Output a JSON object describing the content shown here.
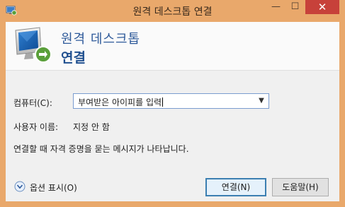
{
  "window": {
    "title": "원격 데스크톱 연결",
    "minimize_glyph": "—",
    "maximize_glyph": "☐",
    "close_glyph": "✕"
  },
  "header": {
    "line1": "원격 데스크톱",
    "line2": "연결"
  },
  "form": {
    "computer_label": "컴퓨터(C):",
    "computer_value": "부여받은 아이피를 입력",
    "user_label": "사용자 이름:",
    "user_value": "지정 안 함",
    "note": "연결할 때 자격 증명을 묻는 메시지가 나타납니다."
  },
  "footer": {
    "options_label": "옵션 표시(O)",
    "connect_label": "연결(N)",
    "help_label": "도움말(H)"
  },
  "colors": {
    "titlebar": "#e9a86b",
    "close": "#c7413a",
    "accent": "#2e5a9a",
    "client": "#f0f0f0"
  },
  "icons": [
    "app-icon",
    "remote-desktop-logo-icon",
    "chevron-down-icon",
    "expand-options-icon"
  ]
}
